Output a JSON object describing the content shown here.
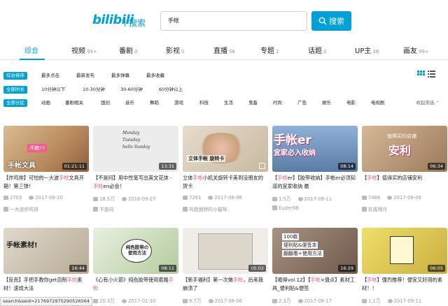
{
  "header": {
    "logo_text": "bilibili",
    "logo_sub": "搜索",
    "search_value": "手帐",
    "search_button": "搜索"
  },
  "tabs": [
    {
      "label": "综合",
      "count": ""
    },
    {
      "label": "视频",
      "count": "99+"
    },
    {
      "label": "番剧",
      "count": "0"
    },
    {
      "label": "影视",
      "count": "0"
    },
    {
      "label": "直播",
      "count": "58"
    },
    {
      "label": "专题",
      "count": "1"
    },
    {
      "label": "话题",
      "count": "0"
    },
    {
      "label": "UP主",
      "count": "36"
    },
    {
      "label": "画友",
      "count": "99+"
    }
  ],
  "filters": {
    "order": [
      "综合排序",
      "最多点击",
      "最新发布",
      "最多弹幕",
      "最多收藏"
    ],
    "duration": [
      "全部时长",
      "10分钟以下",
      "10-30分钟",
      "30-60分钟",
      "60分钟以上"
    ],
    "zone": [
      "全部分区",
      "动画",
      "番剧相关",
      "国创",
      "音乐",
      "舞蹈",
      "游戏",
      "科技",
      "生活",
      "鬼畜",
      "时尚",
      "广告",
      "娱乐",
      "电影",
      "电视剧"
    ],
    "collapse_label": "收起筛选"
  },
  "colors": {
    "accent": "#00a1d6",
    "highlight": "#f25d8e"
  },
  "videos": [
    {
      "pre": "【炸鸡排】可怕的一大波",
      "hl": "手帐",
      "post": "文具开箱！第三弹！",
      "duration": "01:21:11",
      "views": "2703",
      "date": "2017-09-20",
      "up": "一大波炸鸡排",
      "thumb": "#c8a57a"
    },
    {
      "pre": "【不是闷】用中性笔写出英文花体 - ",
      "hl": "手帐",
      "post": "en必会！",
      "duration": "13:31",
      "views": "18.5万",
      "date": "2016-09-27",
      "up": "不是闷",
      "thumb": "#e8e8e8"
    },
    {
      "pre": "立体",
      "hl": "手帐",
      "post": "小机关旋转卡美到没朋友的贺卡",
      "duration": "",
      "views": "7261",
      "date": "2017-09-08",
      "up": "叫我傲娇的小猫咪",
      "thumb": "#d9cfc0"
    },
    {
      "pre": "【",
      "hl": "手帐",
      "post": "er】【胶带收纳】手帐er必须知道的宜家收纳 最",
      "duration": "08:14",
      "views": "1.5万",
      "date": "2017-09-11",
      "up": "Euder98",
      "thumb": "#6f8fb8"
    },
    {
      "pre": "【",
      "hl": "手帐",
      "post": "】值得买的店铺安利",
      "duration": "06:34",
      "views": "7486",
      "date": "2017-09-09",
      "up": "好酱明月",
      "thumb": "#b79a7c"
    },
    {
      "pre": "【反而】手把手教你get自制",
      "hl": "手帐",
      "post": "素材！速成大法",
      "duration": "16:44",
      "views": "",
      "date": "",
      "up": "",
      "thumb": "#cfc6b8"
    },
    {
      "pre": "《心有小火箭》纯色胶带使用套路",
      "hl": "手帐",
      "post": "",
      "duration": "08:11",
      "views": "20.3万",
      "date": "2017-01-20",
      "up": "",
      "thumb": "#d6e4c8"
    },
    {
      "pre": "【新手福利】第一次做",
      "hl": "手帐",
      "post": "，后来我崩溃了",
      "duration": "05:02",
      "views": "8.7万",
      "date": "2017-08-06",
      "up": "",
      "thumb": "#e9e4dc"
    },
    {
      "pre": "【噫得vol.12】【",
      "hl": "手帐",
      "post": "×盘点】素材工具_便利贴&便签",
      "duration": "16:29",
      "views": "2.3万",
      "date": "2017-08-17",
      "up": "",
      "thumb": "#8c7868"
    },
    {
      "pre": "【",
      "hl": "手帐",
      "post": "】强烈推荐！便宜又好用的素材！！",
      "duration": "06:05",
      "views": "1.1万",
      "date": "2017-09-11",
      "up": "",
      "thumb": "#e2cf5a"
    }
  ],
  "thumb_text": {
    "t1_banner": "开箱!!!",
    "t1_main": "手帐文具",
    "t2_script": "Monday Tuesday hello Sunday",
    "t3_caption": "立体手帐 旋转卡",
    "t4_main": "手帐er",
    "t4_sub": "宜家必入收纳",
    "t5_main": "安利",
    "t5_sub": "值得买的店铺",
    "t6_main": "手帐素材!",
    "t7_main": "纯色胶带の使用方法",
    "t9_a": "100款",
    "t9_b": "便利贴&便签本",
    "t9_c": "翻翻看+使用方法"
  },
  "status_url": "search&seid=2176972975290526564"
}
